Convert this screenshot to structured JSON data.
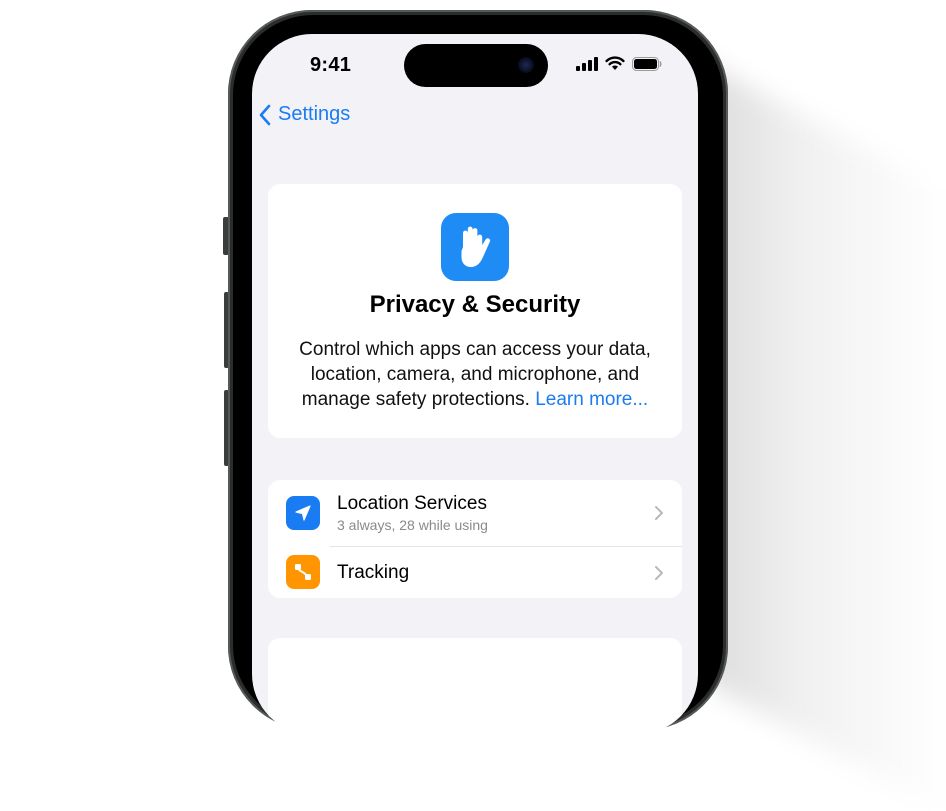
{
  "status_bar": {
    "time": "9:41",
    "icons": [
      "cellular-signal-icon",
      "wifi-icon",
      "battery-icon"
    ]
  },
  "nav": {
    "back_label": "Settings",
    "back_icon": "chevron-left-icon"
  },
  "colors": {
    "accent": "#1a7cf2",
    "privacy_icon_bg": "#1f8cf5",
    "location_icon_bg": "#1a7cf2",
    "tracking_icon_bg": "#ff9500",
    "screen_bg": "#f2f2f7"
  },
  "hero": {
    "icon": "raised-hand-icon",
    "title": "Privacy & Security",
    "description": "Control which apps can access your data, location, camera, and microphone, and manage safety protections.",
    "link_label": "Learn more..."
  },
  "list": {
    "items": [
      {
        "icon": "location-arrow-icon",
        "title": "Location Services",
        "subtitle": "3 always, 28 while using"
      },
      {
        "icon": "tracking-icon",
        "title": "Tracking",
        "subtitle": ""
      }
    ]
  }
}
